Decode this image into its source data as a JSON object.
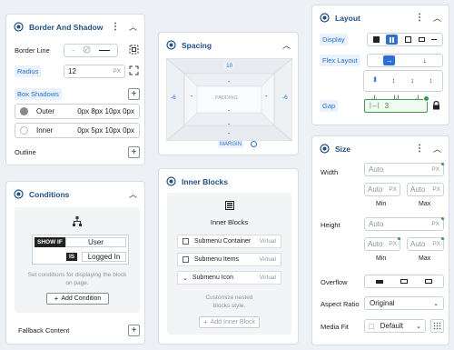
{
  "border": {
    "title": "Border And Shadow",
    "border_line_label": "Border Line",
    "border_none": "-",
    "radius_label": "Radius",
    "radius_value": "12",
    "radius_unit": "PX",
    "box_shadows_label": "Box Shadows",
    "shadows": [
      {
        "name": "Outer",
        "value": "0px 8px 10px 0px"
      },
      {
        "name": "Inner",
        "value": "0px 5px 10px 0px"
      }
    ],
    "outline_label": "Outline"
  },
  "spacing": {
    "title": "Spacing",
    "margin_top": "10",
    "margin_left": "-6",
    "margin_right": "-6",
    "margin_bottom": "-",
    "padding_top": "-",
    "padding_left": "-",
    "padding_right": "-",
    "padding_bottom": "-",
    "padding_label": "PADDING",
    "center": "-",
    "margin_label": "MARGIN"
  },
  "layout": {
    "title": "Layout",
    "display_label": "Display",
    "flex_label": "Flex Layout",
    "gap_label": "Gap",
    "gap_value": "3"
  },
  "size": {
    "title": "Size",
    "width_label": "Width",
    "height_label": "Height",
    "auto": "Auto",
    "px": "PX",
    "min": "Min",
    "max": "Max",
    "overflow_label": "Overflow",
    "aspect_label": "Aspect Ratio",
    "aspect_value": "Original",
    "media_fit_label": "Media Fit",
    "media_fit_value": "Default"
  },
  "conditions": {
    "title": "Conditions",
    "show_if": "SHOW IF",
    "user": "User",
    "is": "IS",
    "logged_in": "Logged In",
    "help": "Set conditions for displaying the block on page.",
    "add": "Add Condition",
    "fallback": "Fallback Content"
  },
  "inner": {
    "title": "Inner Blocks",
    "heading": "Inner Blocks",
    "items": [
      {
        "name": "Submenu Container",
        "tag": "Virtual"
      },
      {
        "name": "Submenu Items",
        "tag": "Virtual"
      },
      {
        "name": "Submenu Icon",
        "tag": "Virtual"
      }
    ],
    "help": "Customize nested blocks style.",
    "add": "Add Inner Block"
  }
}
